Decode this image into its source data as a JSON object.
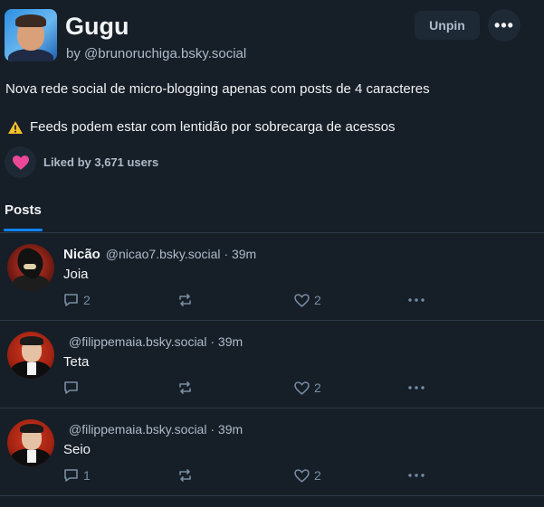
{
  "feed": {
    "title": "Gugu",
    "by_prefix": "by",
    "handle": "@brunoruchiga.bsky.social",
    "description": "Nova rede social de micro-blogging apenas com posts de 4 caracteres",
    "warning": "Feeds podem estar com lentidão por sobrecarga de acessos",
    "unpin_label": "Unpin",
    "more_label": "•••",
    "liked_by": "Liked by 3,671 users"
  },
  "tabs": [
    {
      "label": "Posts",
      "active": true
    }
  ],
  "posts": [
    {
      "author": "Nicão",
      "handle": "@nicao7.bsky.social",
      "time": "· 39m",
      "text": "Joia",
      "replies": "2",
      "likes": "2",
      "avatar": "shadow-avatar"
    },
    {
      "author": "",
      "handle": "@filippemaia.bsky.social",
      "time": "· 39m",
      "text": "Teta",
      "replies": "",
      "likes": "2",
      "avatar": "pacino-avatar"
    },
    {
      "author": "",
      "handle": "@filippemaia.bsky.social",
      "time": "· 39m",
      "text": "Seio",
      "replies": "1",
      "likes": "2",
      "avatar": "pacino-avatar"
    }
  ],
  "colors": {
    "background": "#161e27",
    "accent": "#1083fe",
    "heart": "#ec4899",
    "muted": "#788da3"
  }
}
